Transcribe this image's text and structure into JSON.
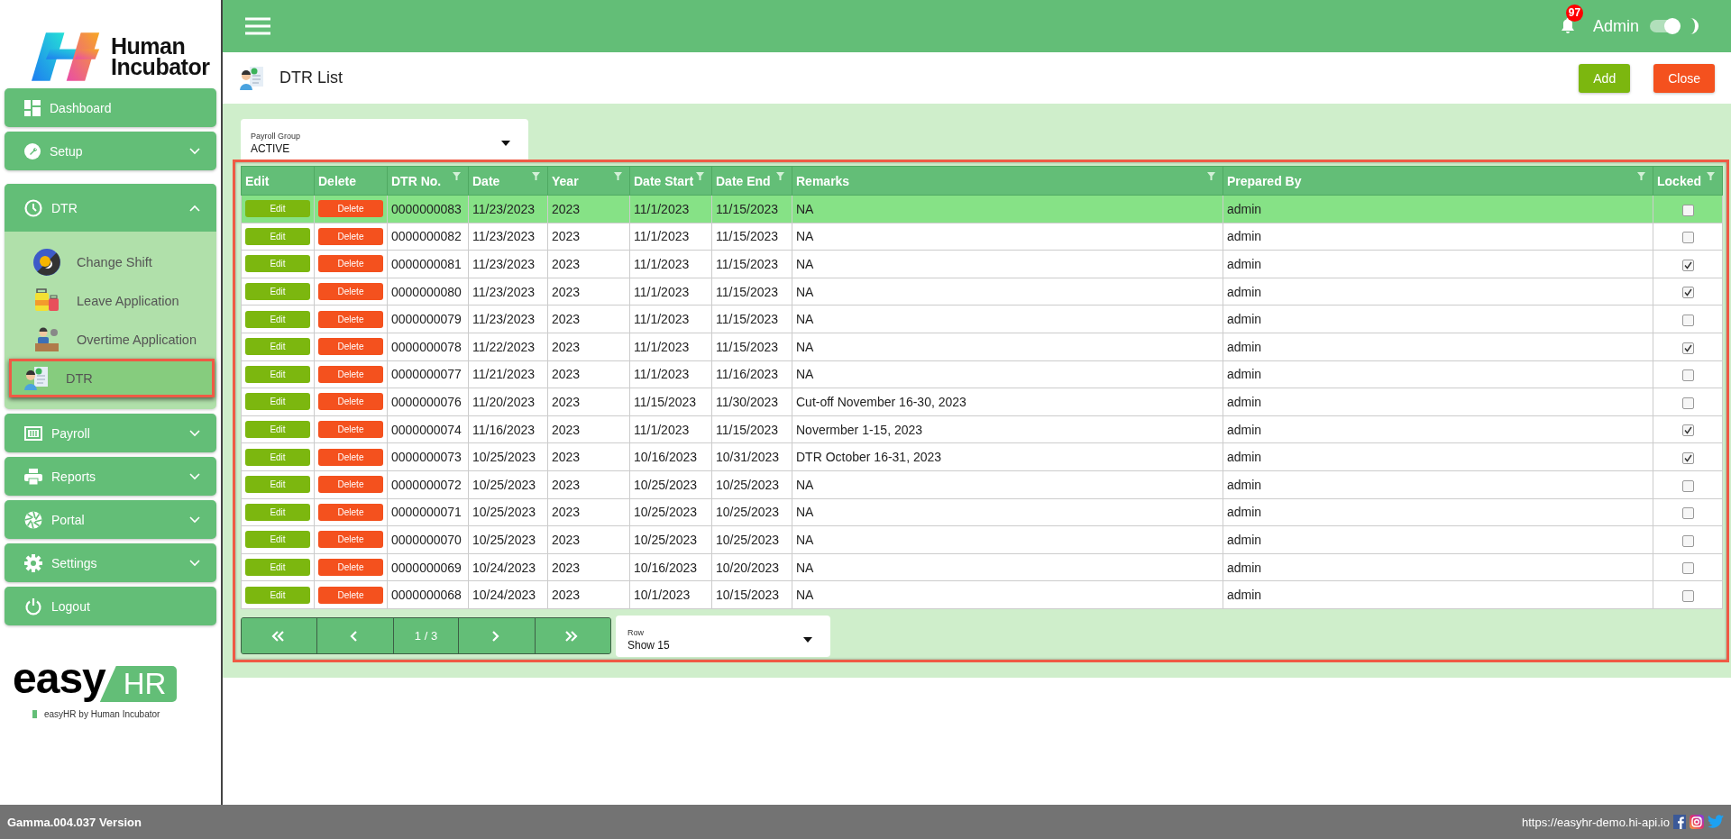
{
  "sidebar": {
    "logo_text": "Human Incubator",
    "items": [
      {
        "label": "Dashboard",
        "kind": "link"
      },
      {
        "label": "Setup",
        "kind": "group",
        "expanded": false
      },
      {
        "label": "DTR",
        "kind": "group",
        "expanded": true,
        "children": [
          {
            "label": "Change Shift",
            "selected": false
          },
          {
            "label": "Leave Application",
            "selected": false
          },
          {
            "label": "Overtime Application",
            "selected": false
          },
          {
            "label": "DTR",
            "selected": true
          }
        ]
      },
      {
        "label": "Payroll",
        "kind": "group",
        "expanded": false
      },
      {
        "label": "Reports",
        "kind": "group",
        "expanded": false
      },
      {
        "label": "Portal",
        "kind": "group",
        "expanded": false
      },
      {
        "label": "Settings",
        "kind": "group",
        "expanded": false
      },
      {
        "label": "Logout",
        "kind": "link"
      }
    ],
    "brand": {
      "word": "easy",
      "badge": "HR",
      "tagline": "easyHR by Human Incubator"
    }
  },
  "header": {
    "notification_count": "97",
    "user": "Admin",
    "theme_switch": {
      "on": true
    }
  },
  "page": {
    "title": "DTR List",
    "buttons": [
      {
        "label": "Add",
        "kind": "add"
      },
      {
        "label": "Close",
        "kind": "close"
      }
    ]
  },
  "filter": {
    "label": "Payroll Group",
    "value": "ACTIVE"
  },
  "table": {
    "columns": [
      {
        "label": "Edit",
        "kind": "edit",
        "filterable": false
      },
      {
        "label": "Delete",
        "kind": "delete",
        "filterable": false
      },
      {
        "label": "DTR No.",
        "kind": "text",
        "filterable": true
      },
      {
        "label": "Date",
        "kind": "text",
        "filterable": true
      },
      {
        "label": "Year",
        "kind": "text",
        "filterable": true
      },
      {
        "label": "Date Start",
        "kind": "text",
        "filterable": true
      },
      {
        "label": "Date End",
        "kind": "text",
        "filterable": true
      },
      {
        "label": "Remarks",
        "kind": "text",
        "filterable": true
      },
      {
        "label": "Prepared By",
        "kind": "text",
        "filterable": true
      },
      {
        "label": "Locked",
        "kind": "checkbox",
        "filterable": true
      }
    ],
    "rows": [
      {
        "cells": [
          "Edit",
          "Delete",
          "0000000083",
          "11/23/2023",
          "2023",
          "11/1/2023",
          "11/15/2023",
          "NA",
          "admin"
        ],
        "locked": false,
        "selected": true
      },
      {
        "cells": [
          "Edit",
          "Delete",
          "0000000082",
          "11/23/2023",
          "2023",
          "11/1/2023",
          "11/15/2023",
          "NA",
          "admin"
        ],
        "locked": false,
        "selected": false
      },
      {
        "cells": [
          "Edit",
          "Delete",
          "0000000081",
          "11/23/2023",
          "2023",
          "11/1/2023",
          "11/15/2023",
          "NA",
          "admin"
        ],
        "locked": true,
        "selected": false
      },
      {
        "cells": [
          "Edit",
          "Delete",
          "0000000080",
          "11/23/2023",
          "2023",
          "11/1/2023",
          "11/15/2023",
          "NA",
          "admin"
        ],
        "locked": true,
        "selected": false
      },
      {
        "cells": [
          "Edit",
          "Delete",
          "0000000079",
          "11/23/2023",
          "2023",
          "11/1/2023",
          "11/15/2023",
          "NA",
          "admin"
        ],
        "locked": false,
        "selected": false
      },
      {
        "cells": [
          "Edit",
          "Delete",
          "0000000078",
          "11/22/2023",
          "2023",
          "11/1/2023",
          "11/15/2023",
          "NA",
          "admin"
        ],
        "locked": true,
        "selected": false
      },
      {
        "cells": [
          "Edit",
          "Delete",
          "0000000077",
          "11/21/2023",
          "2023",
          "11/1/2023",
          "11/16/2023",
          "NA",
          "admin"
        ],
        "locked": false,
        "selected": false
      },
      {
        "cells": [
          "Edit",
          "Delete",
          "0000000076",
          "11/20/2023",
          "2023",
          "11/15/2023",
          "11/30/2023",
          "Cut-off November 16-30, 2023",
          "admin"
        ],
        "locked": false,
        "selected": false
      },
      {
        "cells": [
          "Edit",
          "Delete",
          "0000000074",
          "11/16/2023",
          "2023",
          "11/1/2023",
          "11/15/2023",
          "Novermber 1-15, 2023",
          "admin"
        ],
        "locked": true,
        "selected": false
      },
      {
        "cells": [
          "Edit",
          "Delete",
          "0000000073",
          "10/25/2023",
          "2023",
          "10/16/2023",
          "10/31/2023",
          "DTR October 16-31, 2023",
          "admin"
        ],
        "locked": true,
        "selected": false
      },
      {
        "cells": [
          "Edit",
          "Delete",
          "0000000072",
          "10/25/2023",
          "2023",
          "10/25/2023",
          "10/25/2023",
          "NA",
          "admin"
        ],
        "locked": false,
        "selected": false
      },
      {
        "cells": [
          "Edit",
          "Delete",
          "0000000071",
          "10/25/2023",
          "2023",
          "10/25/2023",
          "10/25/2023",
          "NA",
          "admin"
        ],
        "locked": false,
        "selected": false
      },
      {
        "cells": [
          "Edit",
          "Delete",
          "0000000070",
          "10/25/2023",
          "2023",
          "10/25/2023",
          "10/25/2023",
          "NA",
          "admin"
        ],
        "locked": false,
        "selected": false
      },
      {
        "cells": [
          "Edit",
          "Delete",
          "0000000069",
          "10/24/2023",
          "2023",
          "10/16/2023",
          "10/20/2023",
          "NA",
          "admin"
        ],
        "locked": false,
        "selected": false
      },
      {
        "cells": [
          "Edit",
          "Delete",
          "0000000068",
          "10/24/2023",
          "2023",
          "10/1/2023",
          "10/15/2023",
          "NA",
          "admin"
        ],
        "locked": false,
        "selected": false
      }
    ]
  },
  "pagination": {
    "page": "1 / 3"
  },
  "rows_select": {
    "label": "Row",
    "value": "Show 15"
  },
  "footer": {
    "version": "Gamma.004.037 Version",
    "url": "https://easyhr-demo.hi-api.io"
  }
}
